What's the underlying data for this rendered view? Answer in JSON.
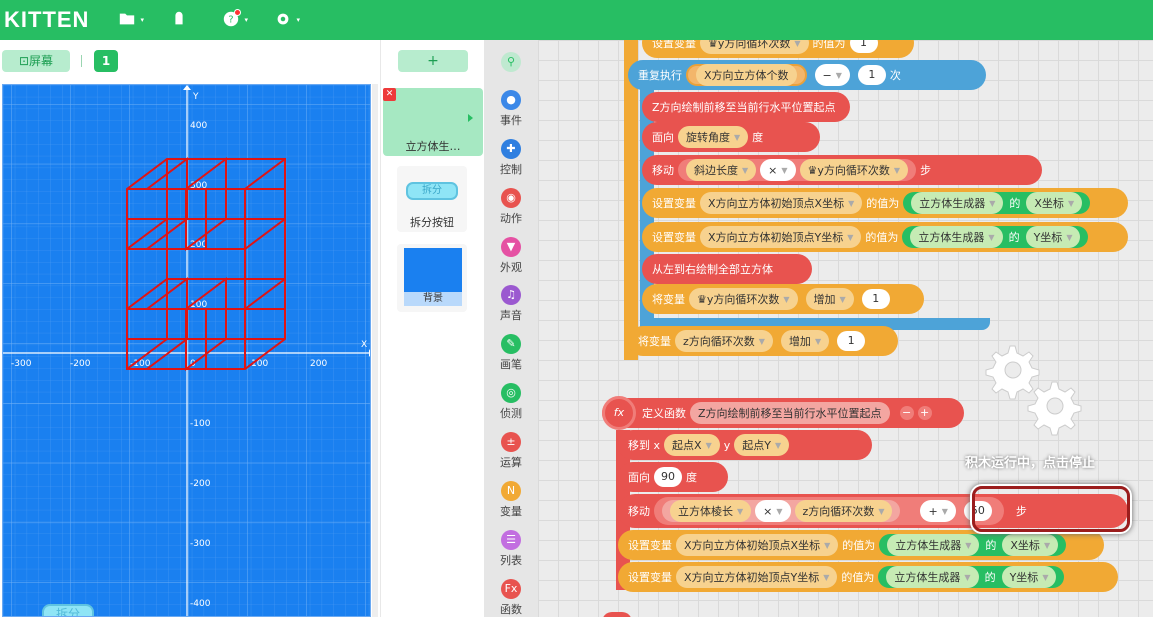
{
  "app": {
    "logo": "KITTEN"
  },
  "left": {
    "screen_label": "屏幕",
    "scene_number": "1"
  },
  "stage_axes": {
    "x_label": "X",
    "y_label": "Y",
    "x_ticks": [
      "-300",
      "-200",
      "-100",
      "0",
      "100",
      "200"
    ],
    "y_ticks": [
      "400",
      "300",
      "200",
      "100",
      "-100",
      "-200",
      "-300",
      "-400"
    ]
  },
  "stage_button": {
    "label": "拆分"
  },
  "sprites": {
    "add_label": "+",
    "items": [
      {
        "name": "立方体生…"
      },
      {
        "name": "拆分按钮",
        "thumb": "拆分"
      },
      {
        "name": "背景"
      }
    ]
  },
  "palette": [
    {
      "label": "",
      "icon": "search-icon",
      "color": "#27be63"
    },
    {
      "label": "事件",
      "icon": "event-icon",
      "color": "#3b88e8"
    },
    {
      "label": "控制",
      "icon": "control-icon",
      "color": "#2f7fe0"
    },
    {
      "label": "动作",
      "icon": "action-icon",
      "color": "#e8534f"
    },
    {
      "label": "外观",
      "icon": "appearance-icon",
      "color": "#e551a3"
    },
    {
      "label": "声音",
      "icon": "sound-icon",
      "color": "#9b59d0"
    },
    {
      "label": "画笔",
      "icon": "pen-icon",
      "color": "#27be63"
    },
    {
      "label": "侦测",
      "icon": "sense-icon",
      "color": "#27be63"
    },
    {
      "label": "运算",
      "icon": "operator-icon",
      "color": "#e8534f"
    },
    {
      "label": "变量",
      "icon": "variable-icon",
      "color": "#f1a934"
    },
    {
      "label": "列表",
      "icon": "list-icon",
      "color": "#c26ee0"
    },
    {
      "label": "函数",
      "icon": "function-icon",
      "color": "#e8534f"
    }
  ],
  "code": {
    "b1": {
      "a": "设置变量",
      "b": "y方向循环次数",
      "c": "的值为",
      "n": "1"
    },
    "b2": {
      "a": "重复执行",
      "b": "X方向立方体个数",
      "op": "−",
      "n": "1",
      "c": "次"
    },
    "b3": {
      "a": "Z方向绘制前移至当前行水平位置起点"
    },
    "b4": {
      "a": "面向",
      "b": "旋转角度",
      "c": "度"
    },
    "b5": {
      "a": "移动",
      "b": "斜边长度",
      "op": "×",
      "d": "y方向循环次数",
      "c": "步"
    },
    "b6": {
      "a": "设置变量",
      "b": "X方向立方体初始顶点X坐标",
      "c": "的值为",
      "d": "立方体生成器",
      "e": "的",
      "f": "X坐标"
    },
    "b7": {
      "a": "设置变量",
      "b": "X方向立方体初始顶点Y坐标",
      "c": "的值为",
      "d": "立方体生成器",
      "e": "的",
      "f": "Y坐标"
    },
    "b8": {
      "a": "从左到右绘制全部立方体"
    },
    "b9": {
      "a": "将变量",
      "b": "y方向循环次数",
      "c": "增加",
      "n": "1"
    },
    "b10": {
      "a": "将变量",
      "b": "z方向循环次数",
      "c": "增加",
      "n": "1"
    },
    "f1": {
      "icon": "fx",
      "a": "定义函数",
      "b": "Z方向绘制前移至当前行水平位置起点"
    },
    "f2": {
      "a": "移到 x",
      "b": "起点X",
      "c": "y",
      "d": "起点Y"
    },
    "f3": {
      "a": "面向",
      "n": "90",
      "c": "度"
    },
    "f4": {
      "a": "移动",
      "b": "立方体棱长",
      "op": "×",
      "d": "z方向循环次数",
      "op2": "+",
      "n": "50",
      "c": "步"
    },
    "f5": {
      "a": "设置变量",
      "b": "X方向立方体初始顶点X坐标",
      "c": "的值为",
      "d": "立方体生成器",
      "e": "的",
      "f": "X坐标"
    },
    "f6": {
      "a": "设置变量",
      "b": "X方向立方体初始顶点Y坐标",
      "c": "的值为",
      "d": "立方体生成器",
      "e": "的",
      "f": "Y坐标"
    }
  },
  "running": {
    "message": "积木运行中，点击停止"
  }
}
